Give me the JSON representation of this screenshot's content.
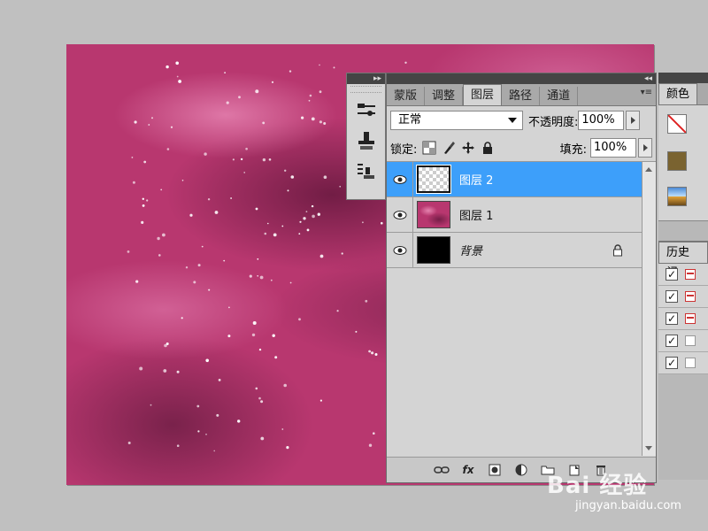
{
  "toolstrip": {
    "collapse_glyph": "▸▸"
  },
  "layers_panel": {
    "collapse_glyph": "◂◂",
    "tabs": [
      {
        "label": "蒙版"
      },
      {
        "label": "调整"
      },
      {
        "label": "图层"
      },
      {
        "label": "路径"
      },
      {
        "label": "通道"
      }
    ],
    "active_tab": "图层",
    "menu_glyph": "▾≡",
    "blend_mode": "正常",
    "opacity_label": "不透明度:",
    "opacity_value": "100%",
    "lock_label": "锁定:",
    "fill_label": "填充:",
    "fill_value": "100%",
    "layers": [
      {
        "name": "图层 2",
        "selected": true,
        "visible": true,
        "thumb": "transparent"
      },
      {
        "name": "图层 1",
        "selected": false,
        "visible": true,
        "thumb": "pink-cloud"
      },
      {
        "name": "背景",
        "selected": false,
        "visible": true,
        "thumb": "black",
        "locked": true
      }
    ],
    "bottom_icons": [
      "link-icon",
      "fx-icon",
      "mask-icon",
      "adjustment-icon",
      "folder-icon",
      "new-layer-icon",
      "trash-icon"
    ],
    "fx_label": "fx"
  },
  "right_dock": {
    "color_tab": "颜色",
    "history_tab": "历史记"
  },
  "watermark": {
    "logo": "Bai 经验",
    "url": "jingyan.baidu.com"
  },
  "colors": {
    "canvas_base": "#b8376f",
    "selection_blue": "#3d9ffa",
    "panel_gray": "#d4d4d4"
  }
}
